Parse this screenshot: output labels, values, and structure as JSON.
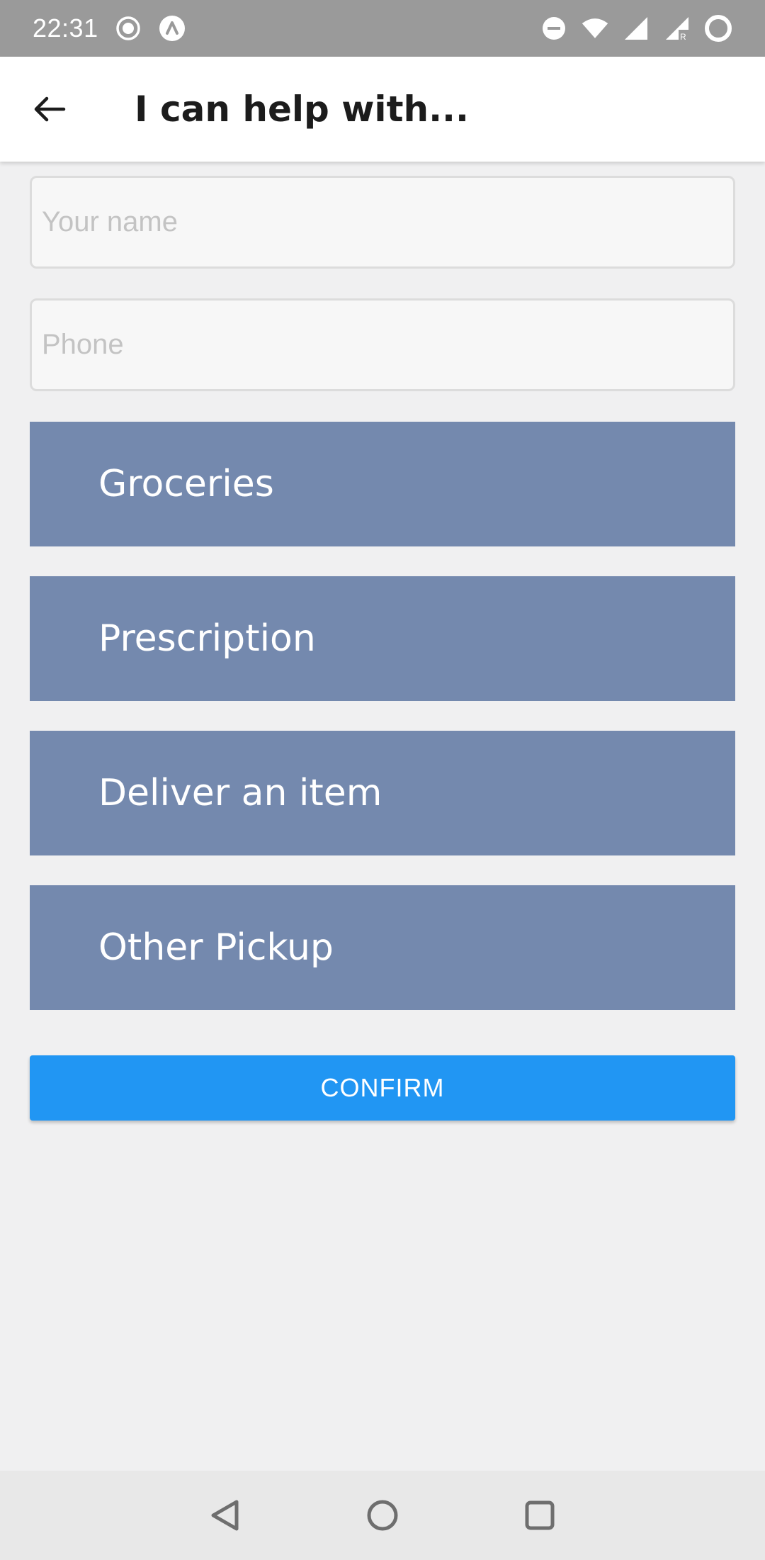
{
  "status_bar": {
    "time": "22:31",
    "left_icons": [
      "record-icon",
      "arrow-up-circle-icon"
    ],
    "right_icons": [
      "do-not-disturb-icon",
      "wifi-icon",
      "signal-icon",
      "signal-roaming-icon",
      "battery-ring-icon"
    ]
  },
  "app_bar": {
    "title": "I can help with..."
  },
  "form": {
    "name_placeholder": "Your name",
    "name_value": "",
    "phone_placeholder": "Phone",
    "phone_value": ""
  },
  "options": [
    {
      "label": "Groceries"
    },
    {
      "label": "Prescription"
    },
    {
      "label": "Deliver an item"
    },
    {
      "label": "Other Pickup"
    }
  ],
  "confirm_label": "CONFIRM",
  "colors": {
    "status_bar": "#9a9a9a",
    "option_background": "#7489ae",
    "confirm_background": "#2196f3",
    "background": "#f0f0f1"
  }
}
